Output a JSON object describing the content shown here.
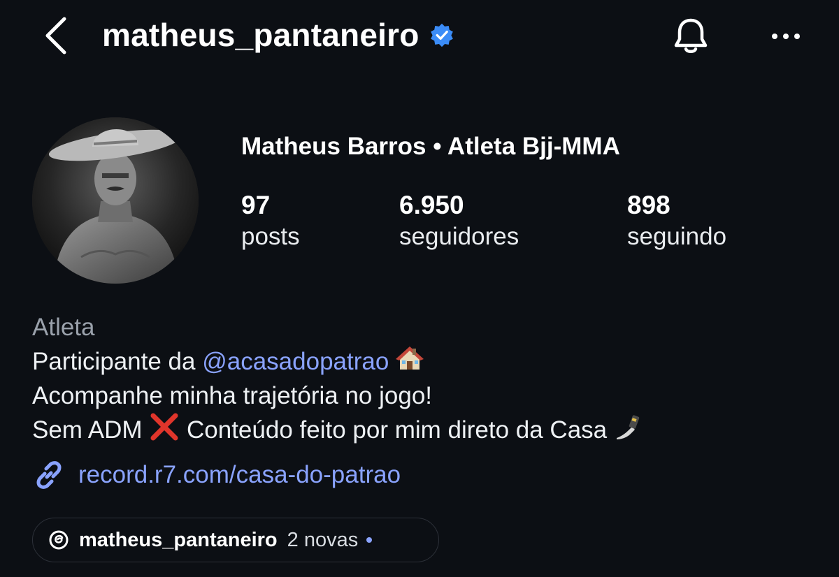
{
  "header": {
    "username": "matheus_pantaneiro",
    "verified": true,
    "icons": {
      "back": "chevron-left-icon",
      "verified": "verified-badge-icon",
      "notifications": "bell-icon",
      "more": "more-horizontal-icon"
    }
  },
  "profile": {
    "display_name": "Matheus Barros • Atleta Bjj-MMA",
    "stats": [
      {
        "value": "97",
        "label": "posts"
      },
      {
        "value": "6.950",
        "label": "seguidores"
      },
      {
        "value": "898",
        "label": "seguindo"
      }
    ]
  },
  "bio": {
    "category": "Atleta",
    "line1_prefix": "Participante da ",
    "line1_mention": "@acasadopatrao",
    "line1_emoji": "house-emoji",
    "line2": "Acompanhe minha trajetória no jogo!",
    "line3_prefix": "Sem ADM ",
    "line3_emoji_mid": "cross-mark-emoji",
    "line3_suffix": " Conteúdo feito por mim direto da Casa ",
    "line3_emoji_end": "selfie-emoji",
    "link": "record.r7.com/casa-do-patrao"
  },
  "threads": {
    "username": "matheus_pantaneiro",
    "new_label": "2 novas"
  },
  "colors": {
    "background": "#0c0f14",
    "link": "#8aa3ff",
    "verified": "#3b8cf7",
    "muted": "#9aa1ab"
  }
}
